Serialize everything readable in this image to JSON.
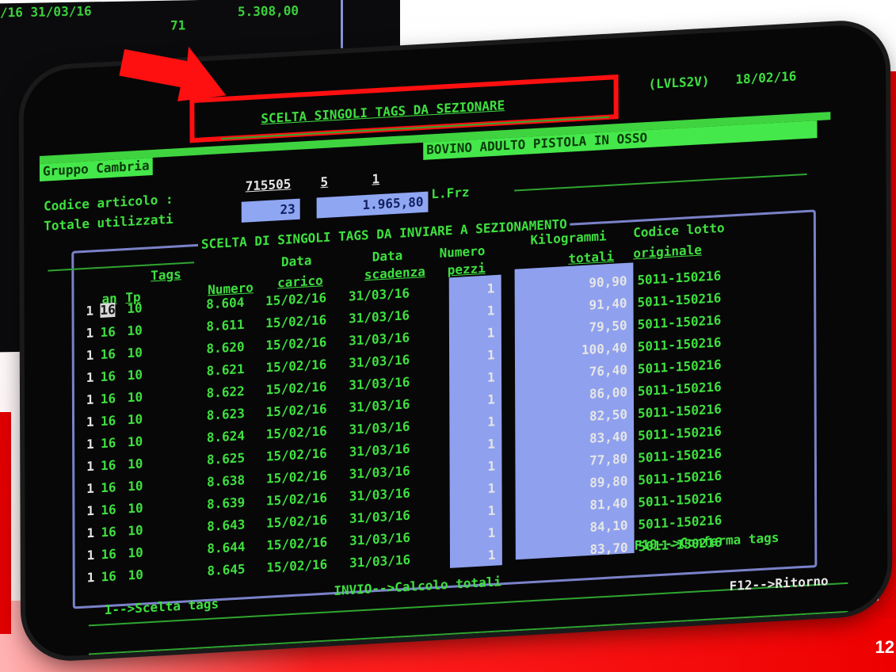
{
  "background_screen": {
    "line1": "/16 31/03/16",
    "line2_a": "71",
    "line2_b": "5.308,00"
  },
  "header": {
    "title": "SCELTA SINGOLI TAGS DA SEZIONARE",
    "program_code": "(LVLS2V)",
    "date": "18/02/16"
  },
  "group": {
    "label": "Gruppo Cambria",
    "description": "BOVINO ADULTO PISTOLA IN OSSO"
  },
  "form": {
    "codice_label": "Codice articolo :",
    "codice_1": "715505",
    "codice_2": "5",
    "codice_3": "1",
    "totale_label": "Totale utilizzati",
    "totale_count": "23",
    "totale_amount": "1.965,80",
    "unit": "L.Frz"
  },
  "section": {
    "title": "SCELTA DI SINGOLI TAGS DA INVIARE A SEZIONAMENTO"
  },
  "table": {
    "hdr_tags": "Tags",
    "hdr_data1": "Data",
    "hdr_data2": "Data",
    "hdr_numero1": "Numero",
    "hdr_kg": "Kilogrammi",
    "hdr_codice": "Codice lotto",
    "hdr_an": "an",
    "hdr_tp": "Tp",
    "hdr_numero": "Numero",
    "hdr_carico": "carico",
    "hdr_scadenza": "scadenza",
    "hdr_pezzi": "pezzi",
    "hdr_totali": "totali",
    "hdr_originale": "originale",
    "rows": [
      {
        "sel": "1",
        "an": "16",
        "tp": "10",
        "num": "8.604",
        "carico": "15/02/16",
        "scad": "31/03/16",
        "pezzi": "1",
        "kg": "90,90",
        "lotto": "5011-150216"
      },
      {
        "sel": "1",
        "an": "16",
        "tp": "10",
        "num": "8.611",
        "carico": "15/02/16",
        "scad": "31/03/16",
        "pezzi": "1",
        "kg": "91,40",
        "lotto": "5011-150216"
      },
      {
        "sel": "1",
        "an": "16",
        "tp": "10",
        "num": "8.620",
        "carico": "15/02/16",
        "scad": "31/03/16",
        "pezzi": "1",
        "kg": "79,50",
        "lotto": "5011-150216"
      },
      {
        "sel": "1",
        "an": "16",
        "tp": "10",
        "num": "8.621",
        "carico": "15/02/16",
        "scad": "31/03/16",
        "pezzi": "1",
        "kg": "100,40",
        "lotto": "5011-150216"
      },
      {
        "sel": "1",
        "an": "16",
        "tp": "10",
        "num": "8.622",
        "carico": "15/02/16",
        "scad": "31/03/16",
        "pezzi": "1",
        "kg": "76,40",
        "lotto": "5011-150216"
      },
      {
        "sel": "1",
        "an": "16",
        "tp": "10",
        "num": "8.623",
        "carico": "15/02/16",
        "scad": "31/03/16",
        "pezzi": "1",
        "kg": "86,00",
        "lotto": "5011-150216"
      },
      {
        "sel": "1",
        "an": "16",
        "tp": "10",
        "num": "8.624",
        "carico": "15/02/16",
        "scad": "31/03/16",
        "pezzi": "1",
        "kg": "82,50",
        "lotto": "5011-150216"
      },
      {
        "sel": "1",
        "an": "16",
        "tp": "10",
        "num": "8.625",
        "carico": "15/02/16",
        "scad": "31/03/16",
        "pezzi": "1",
        "kg": "83,40",
        "lotto": "5011-150216"
      },
      {
        "sel": "1",
        "an": "16",
        "tp": "10",
        "num": "8.638",
        "carico": "15/02/16",
        "scad": "31/03/16",
        "pezzi": "1",
        "kg": "77,80",
        "lotto": "5011-150216"
      },
      {
        "sel": "1",
        "an": "16",
        "tp": "10",
        "num": "8.639",
        "carico": "15/02/16",
        "scad": "31/03/16",
        "pezzi": "1",
        "kg": "89,80",
        "lotto": "5011-150216"
      },
      {
        "sel": "1",
        "an": "16",
        "tp": "10",
        "num": "8.643",
        "carico": "15/02/16",
        "scad": "31/03/16",
        "pezzi": "1",
        "kg": "81,40",
        "lotto": "5011-150216"
      },
      {
        "sel": "1",
        "an": "16",
        "tp": "10",
        "num": "8.644",
        "carico": "15/02/16",
        "scad": "31/03/16",
        "pezzi": "1",
        "kg": "84,10",
        "lotto": "5011-150216"
      },
      {
        "sel": "1",
        "an": "16",
        "tp": "10",
        "num": "8.645",
        "carico": "15/02/16",
        "scad": "31/03/16",
        "pezzi": "1",
        "kg": "83,70",
        "lotto": "5011-150216"
      }
    ]
  },
  "footer": {
    "scelta": "1-->Scelta tags",
    "invio": "INVIO-->Calcolo totali",
    "f10": "F10-->Conferma tags",
    "f12": "F12-->Ritorno"
  },
  "slide": {
    "page_number": "12"
  },
  "colors": {
    "terminal_bg": "#070708",
    "terminal_text": "#3fe03f",
    "field_blue": "#8fa6f2",
    "highlight_green": "#45e84a",
    "annotation_red": "#ff1010"
  }
}
